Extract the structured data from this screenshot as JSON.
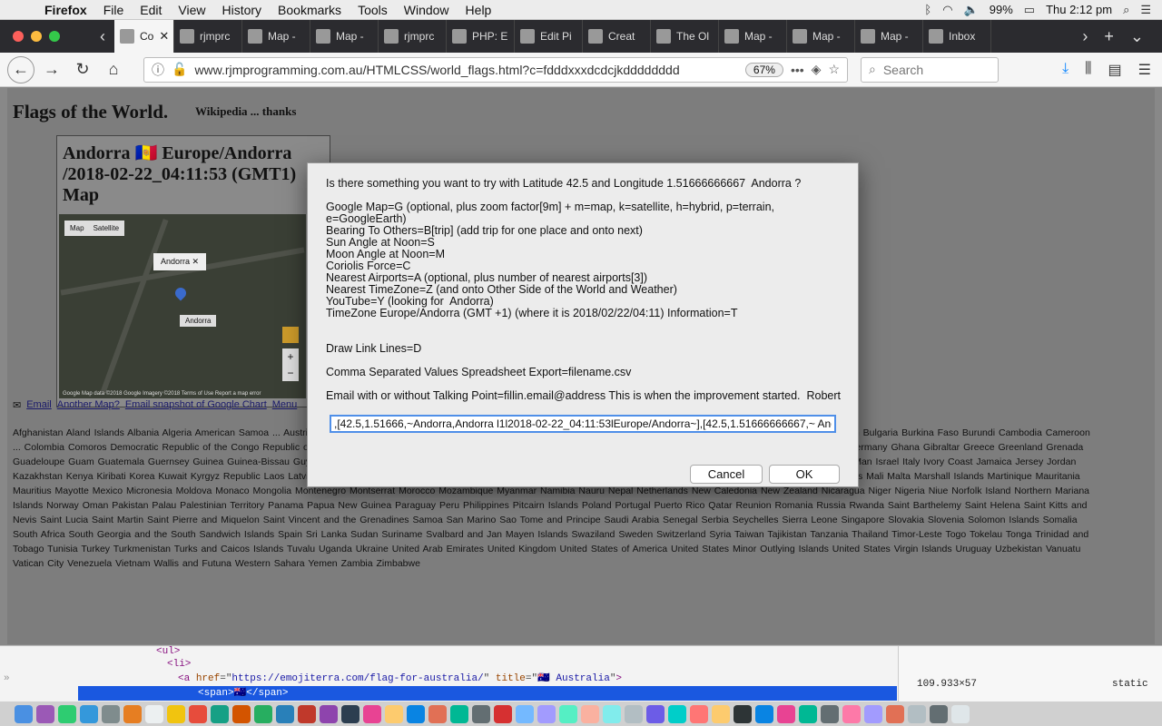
{
  "menubar": {
    "app": "Firefox",
    "items": [
      "File",
      "Edit",
      "View",
      "History",
      "Bookmarks",
      "Tools",
      "Window",
      "Help"
    ],
    "battery": "99%",
    "clock": "Thu 2:12 pm"
  },
  "tabs": {
    "active_label": "Co",
    "others": [
      "rjmprc",
      "Map -",
      "Map -",
      "rjmprc",
      "PHP: E",
      "Edit Pi",
      "Creat",
      "The Ol",
      "Map -",
      "Map -",
      "Map -",
      "Inbox"
    ]
  },
  "navbar": {
    "url": "www.rjmprogramming.com.au/HTMLCSS/world_flags.html?c=fdddxxxdcdcjkdddddddd",
    "zoom": "67%",
    "search_placeholder": "Search"
  },
  "page": {
    "title": "Flags of the World.",
    "subtitle": "Wikipedia ... thanks",
    "map_title": "Andorra 🇦🇩 Europe/Andorra\n/2018-02-22_04:11:53 (GMT1)\nMap",
    "map_type_map": "Map",
    "map_type_satellite": "Satellite",
    "map_info": "Andorra",
    "map_label": "Andorra",
    "map_attribution": "Google   Map data ©2018 Google Imagery ©2018   Terms of Use   Report a map error",
    "email_link": "Email",
    "another_map_link": "Another Map?",
    "snapshot_link": "Email snapshot of Google Chart",
    "menu_link": "Menu",
    "flags_text": "Afghanistan  Aland Islands  Albania  Algeria  American Samoa ... Austria  Azerbaijan  Bahamas  Bahrain  Bangladesh  Barbados  Belarus  Belgium  Belize  Benin ... British Virgin Islands  Brunei Darussalam  Bulgaria  Burkina Faso  Burundi  Cambodia  Cameroon ... Colombia  Comoros  Democratic Republic of the Congo  Republic of the Congo  Cook Islands ... Egypt  El Salvador  Equatorial Guinea  Eritrea  Estonia  Ethiopia  Faroe Islands  Falkland Islands ... Germany  Ghana  Gibraltar  Greece  Greenland  Grenada  Guadeloupe  Guam  Guatemala  Guernsey  Guinea  Guinea-Bissau  Guyana  Haiti  Heard Island and McDonald Islands  Honduras  Hong Kong  Hungary  Iceland  India  Indonesia  Iran  Iraq  Ireland  Isle of Man  Israel  Italy  Ivory Coast  Jamaica  Jersey  Jordan  Kazakhstan  Kenya  Kiribati  Korea  Kuwait  Kyrgyz Republic  Laos  Latvia  Lebanon  Lesotho  Liberia  Libya  Liechtenstein  Lithuania  Luxembourg  Macao  Macedonia  Madagascar  Malawi  Malaysia  Maldives  Mali  Malta  Marshall Islands  Martinique  Mauritania  Mauritius  Mayotte  Mexico  Micronesia  Moldova  Monaco  Mongolia  Montenegro  Montserrat  Morocco  Mozambique  Myanmar  Namibia  Nauru  Nepal  Netherlands  New Caledonia  New Zealand  Nicaragua  Niger  Nigeria  Niue  Norfolk Island  Northern Mariana Islands  Norway  Oman  Pakistan  Palau  Palestinian Territory  Panama  Papua New Guinea  Paraguay  Peru  Philippines  Pitcairn Islands  Poland  Portugal  Puerto Rico  Qatar  Reunion  Romania  Russia  Rwanda  Saint Barthelemy  Saint Helena  Saint Kitts and Nevis  Saint Lucia  Saint Martin  Saint Pierre and Miquelon  Saint Vincent and the Grenadines  Samoa  San Marino  Sao Tome and Principe  Saudi Arabia  Senegal  Serbia  Seychelles  Sierra Leone  Singapore  Slovakia  Slovenia  Solomon Islands  Somalia  South Africa  South Georgia and the South Sandwich Islands  Spain  Sri Lanka  Sudan  Suriname  Svalbard and Jan Mayen Islands  Swaziland  Sweden  Switzerland  Syria  Taiwan  Tajikistan  Tanzania  Thailand  Timor-Leste  Togo  Tokelau  Tonga  Trinidad and Tobago  Tunisia  Turkey  Turkmenistan  Turks and Caicos Islands  Tuvalu  Uganda  Ukraine  United Arab Emirates  United Kingdom  United States of America  United States Minor Outlying Islands  United States Virgin Islands  Uruguay  Uzbekistan  Vanuatu  Vatican City  Venezuela  Vietnam  Wallis and Futuna  Western Sahara  Yemen  Zambia  Zimbabwe"
  },
  "devtools": {
    "line1": "<ul>",
    "line2": "<li>",
    "line3_href": "https://emojiterra.com/flag-for-australia/",
    "line3_title": "🇦🇺 Australia",
    "line4": "<span>🇦🇺</span>",
    "size": "109.933×57",
    "position": "static"
  },
  "dialog": {
    "message": "Is there something you want to try with Latitude 42.5 and Longitude 1.51666666667  Andorra ?\n\nGoogle Map=G (optional, plus zoom factor[9m] + m=map, k=satellite, h=hybrid, p=terrain, e=GoogleEarth)\nBearing To Others=B[trip] (add trip for one place and onto next)\nSun Angle at Noon=S\nMoon Angle at Noon=M\nCoriolis Force=C\nNearest Airports=A (optional, plus number of nearest airports[3])\nNearest TimeZone=Z (and onto Other Side of the World and Weather)\nYouTube=Y (looking for  Andorra)\nTimeZone Europe/Andorra (GMT +1) (where it is 2018/02/22/04:11) Information=T\n\n\nDraw Link Lines=D\n\nComma Separated Values Spreadsheet Export=filename.csv\n\nEmail with or without Talking Point=fillin.email@address This is when the improvement started.  Robert\n\n    else leave as blank or as is or choose Cancel to leave the status quo",
    "input_value": ",[42.5,1.51666,~Andorra,Andorra l1l2018-02-22_04:11:53lEurope/Andorra~],[42.5,1.51666666667,~ Andorra",
    "cancel": "Cancel",
    "ok": "OK"
  }
}
